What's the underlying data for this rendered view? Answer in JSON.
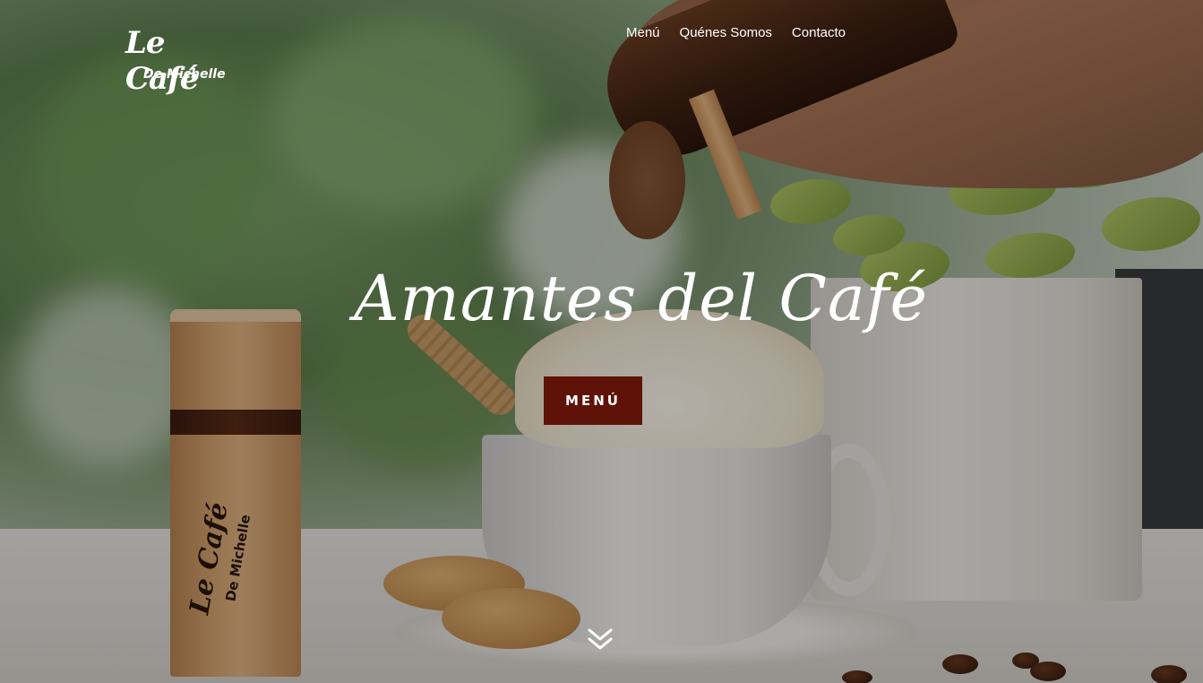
{
  "header": {
    "logo": {
      "main": "Le Café",
      "sub": "De Michelle"
    },
    "nav": [
      {
        "label": "Menú"
      },
      {
        "label": "Quénes Somos"
      },
      {
        "label": "Contacto"
      }
    ]
  },
  "hero": {
    "title": "Amantes del Café",
    "cta_label": "MENÚ",
    "cta_color": "#5f1208",
    "scroll_icon": "double-chevron-down-icon"
  },
  "grinder_logo": {
    "main": "Le Café",
    "sub": "De Michelle"
  }
}
